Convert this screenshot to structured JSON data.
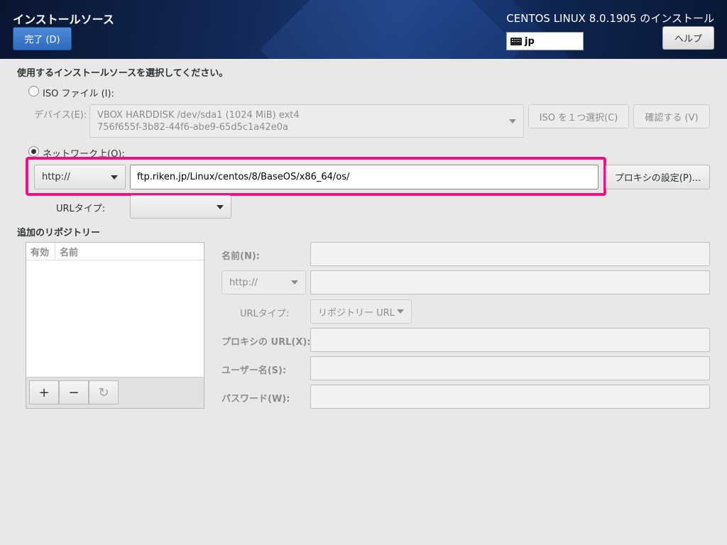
{
  "header": {
    "title": "インストールソース",
    "done_label": "完了 (D)",
    "product": "CENTOS LINUX 8.0.1905 のインストール",
    "keyboard_layout": "jp",
    "help_label": "ヘルプ"
  },
  "main": {
    "prompt": "使用するインストールソースを選択してください。",
    "iso": {
      "radio_label": "ISO ファイル (I):",
      "selected": false,
      "device_label": "デバイス(E):",
      "device_line1": "VBOX HARDDISK /dev/sda1 (1024 MiB) ext4",
      "device_line2": "756f655f-3b82-44f6-abe9-65d5c1a42e0a",
      "choose_iso_label": "ISO を１つ選択(C)",
      "verify_label": "確認する (V)"
    },
    "network": {
      "radio_label": "ネットワーク上(O):",
      "selected": true,
      "protocol": "http://",
      "url": "ftp.riken.jp/Linux/centos/8/BaseOS/x86_64/os/",
      "proxy_label": "プロキシの設定(P)...",
      "url_type_label": "URLタイプ:",
      "url_type_value": ""
    },
    "repos": {
      "heading": "追加のリポジトリー",
      "col_enabled": "有効",
      "col_name": "名前",
      "add_label": "+",
      "remove_label": "−",
      "refresh_label": "↻",
      "name_label": "名前(N):",
      "protocol": "http://",
      "url_type_label": "URLタイプ:",
      "url_type_value": "リポジトリー URL",
      "proxy_url_label": "プロキシの URL(X):",
      "user_label": "ユーザー名(S):",
      "password_label": "パスワード(W):"
    }
  },
  "colors": {
    "highlight": "#ee1188",
    "done_button": "#3a78cc"
  }
}
